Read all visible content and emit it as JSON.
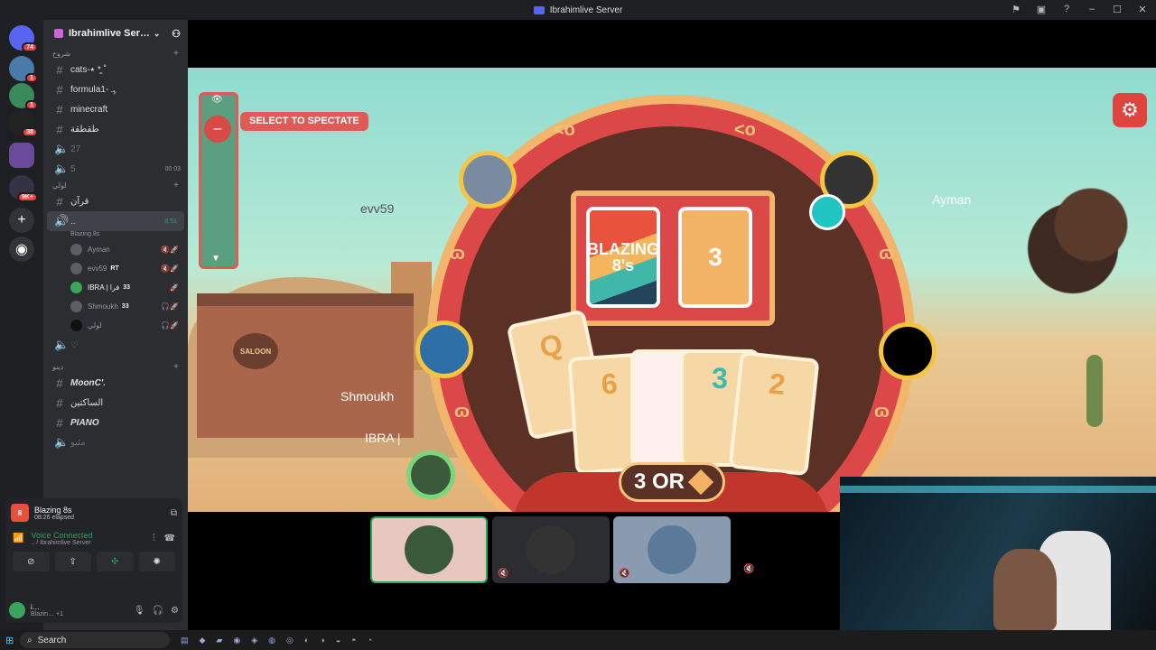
{
  "window": {
    "title": "Ibrahimlive Server"
  },
  "guilds": {
    "badges": [
      "74",
      "1",
      "1",
      "38",
      "9K+"
    ]
  },
  "server": {
    "name": "Ibrahimlive Ser…"
  },
  "categories": {
    "c1": "شروح",
    "c2": "لولي",
    "c3": "دينو"
  },
  "channels": {
    "cats": "cats-٭ * ͚˚",
    "formula": "formula1- ﮩـ",
    "minecraft": "minecraft",
    "arabic1": "طقطقة",
    "v27": "27",
    "v5": "5",
    "v5_count1": "00",
    "v5_count2": "03",
    "quran": "قرآن",
    "active_name": "..",
    "active_time": "8:51",
    "active_sub": "Blazing 8s",
    "heart": "♡",
    "moon": "MoonC'.",
    "arabic2": "الساكتين",
    "piano": "PIANO",
    "arabic3": "مثيو"
  },
  "voice_users": [
    {
      "name": "Ayman",
      "tag": ""
    },
    {
      "name": "evv59",
      "tag": "RT"
    },
    {
      "name": "IBRA | فرا",
      "tag": "33"
    },
    {
      "name": "Shmoukh",
      "tag": "33"
    },
    {
      "name": "لولي",
      "tag": ""
    }
  ],
  "activity": {
    "title": "Blazing 8s",
    "elapsed": "08:26 elapsed",
    "voice_status": "Voice Connected",
    "voice_path": ".. / Ibrahimlive Server"
  },
  "user": {
    "name": "i…",
    "status": "Blazin…",
    "extra": "+1"
  },
  "game": {
    "spectate_label": "SELECT TO SPECTATE",
    "deck_label": "BLAZING 8's",
    "discard_value": "3",
    "call_text": "3 OR",
    "players": {
      "top_left": "evv59",
      "top_right": "Ayman",
      "left": "Shmoukh",
      "bottom_left": "IBRA |"
    },
    "hand": [
      "Q",
      "6",
      "",
      "3",
      "2"
    ]
  },
  "taskbar": {
    "search": "Search"
  },
  "colors": {
    "accent": "#dc4848",
    "gold": "#f2b56c",
    "green": "#23a55a",
    "discord": "#5865f2"
  }
}
